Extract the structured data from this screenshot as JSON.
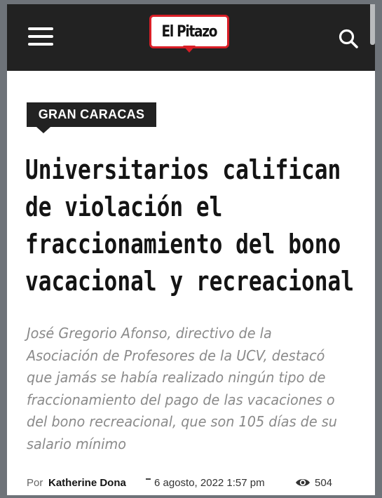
{
  "header": {
    "logo_text": "El Pitazo",
    "brand_color": "#d81e26",
    "bar_color": "#222222",
    "menu_icon": "hamburger-menu-icon",
    "search_icon": "search-icon"
  },
  "article": {
    "section": "GRAN CARACAS",
    "headline": "Universitarios califican de violación el fraccionamiento del bono vacacional y recreacional",
    "summary": "José Gregorio Afonso, directivo de la Asociación de Profesores de la UCV, destacó que jamás se había realizado ningún tipo de fraccionamiento del pago de las vacaciones o del bono recreacional, que son 105 días de su salario mínimo",
    "meta": {
      "by_label": "Por",
      "author": "Katherine Dona",
      "date": "6 agosto, 2022 1:57 pm",
      "views_icon": "eye-icon",
      "views": "504"
    }
  }
}
